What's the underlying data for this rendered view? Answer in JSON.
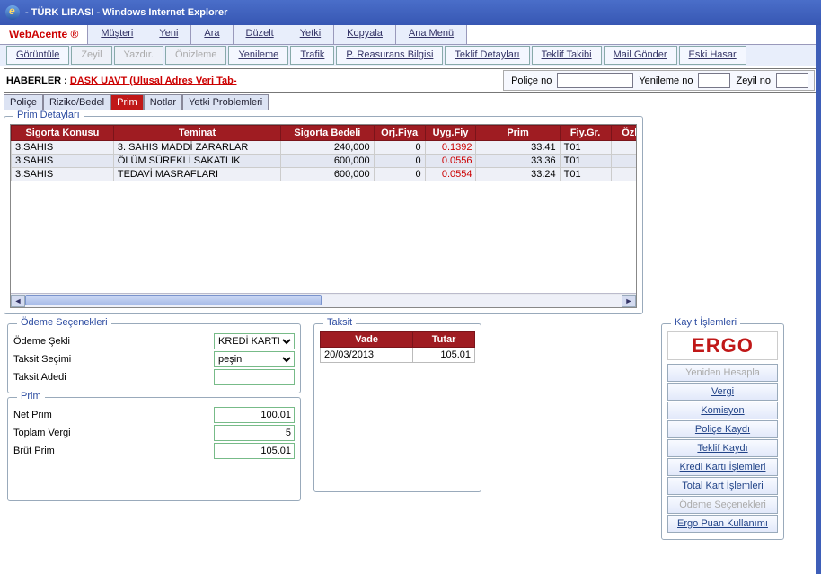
{
  "window": {
    "title": "- TÜRK LIRASI - Windows Internet Explorer"
  },
  "brand": "WebAcente ®",
  "menu": [
    "Müşteri",
    "Yeni",
    "Ara",
    "Düzelt",
    "Yetki",
    "Kopyala",
    "Ana Menü"
  ],
  "toolbar": [
    {
      "label": "Görüntüle",
      "disabled": false
    },
    {
      "label": "Zeyil",
      "disabled": true
    },
    {
      "label": "Yazdır.",
      "disabled": true
    },
    {
      "label": "Önizleme",
      "disabled": true
    },
    {
      "label": "Yenileme",
      "disabled": false
    },
    {
      "label": "Trafik",
      "disabled": false
    },
    {
      "label": "P. Reasurans Bilgisi",
      "disabled": false
    },
    {
      "label": "Teklif Detayları",
      "disabled": false
    },
    {
      "label": "Teklif Takibi",
      "disabled": false
    },
    {
      "label": "Mail Gönder",
      "disabled": false
    },
    {
      "label": "Eski Hasar",
      "disabled": false
    }
  ],
  "news": {
    "label": "HABERLER : ",
    "text": "DASK UAVT (Ulusal Adres Veri Tab-"
  },
  "policy_fields": {
    "police_label": "Poliçe no",
    "yenileme_label": "Yenileme no",
    "zeyil_label": "Zeyil no",
    "police_val": "",
    "yenileme_val": "",
    "zeyil_val": ""
  },
  "subtabs": [
    {
      "label": "Poliçe",
      "active": false
    },
    {
      "label": "Riziko/Bedel",
      "active": false
    },
    {
      "label": "Prim",
      "active": true
    },
    {
      "label": "Notlar",
      "active": false
    },
    {
      "label": "Yetki Problemleri",
      "active": false
    }
  ],
  "prim_legend": "Prim Detayları",
  "prim_headers": [
    "Sigorta Konusu",
    "Teminat",
    "Sigorta Bedeli",
    "Orj.Fiya",
    "Uyg.Fiy",
    "Prim",
    "Fiy.Gr.",
    "Özl"
  ],
  "prim_rows": [
    {
      "konu": "3.SAHIS",
      "teminat": "3. SAHIS MADDİ ZARARLAR",
      "bedel": "240,000",
      "orj": "0",
      "uyg": "0.1392",
      "prim": "33.41",
      "grp": "T01"
    },
    {
      "konu": "3.SAHIS",
      "teminat": "ÖLÜM SÜREKLİ SAKATLIK",
      "bedel": "600,000",
      "orj": "0",
      "uyg": "0.0556",
      "prim": "33.36",
      "grp": "T01"
    },
    {
      "konu": "3.SAHIS",
      "teminat": "TEDAVİ MASRAFLARI",
      "bedel": "600,000",
      "orj": "0",
      "uyg": "0.0554",
      "prim": "33.24",
      "grp": "T01"
    }
  ],
  "odeme": {
    "legend": "Ödeme Seçenekleri",
    "sekli_label": "Ödeme Şekli",
    "sekli_val": "KREDİ KARTI",
    "taksit_label": "Taksit Seçimi",
    "taksit_val": "peşin",
    "adet_label": "Taksit Adedi",
    "adet_val": ""
  },
  "prim_box": {
    "legend": "Prim",
    "net_label": "Net Prim",
    "net_val": "100.01",
    "vergi_label": "Toplam Vergi",
    "vergi_val": "5",
    "brut_label": "Brüt Prim",
    "brut_val": "105.01"
  },
  "taksit_box": {
    "legend": "Taksit",
    "headers": [
      "Vade",
      "Tutar"
    ],
    "rows": [
      {
        "vade": "20/03/2013",
        "tutar": "105.01"
      }
    ]
  },
  "kayit": {
    "legend": "Kayıt İşlemleri",
    "logo": "ERGO",
    "buttons": [
      {
        "label": "Yeniden Hesapla",
        "disabled": true
      },
      {
        "label": "Vergi",
        "disabled": false
      },
      {
        "label": "Komisyon",
        "disabled": false
      },
      {
        "label": "Poliçe Kaydı",
        "disabled": false
      },
      {
        "label": "Teklif Kaydı",
        "disabled": false
      },
      {
        "label": "Kredi Kartı İşlemleri",
        "disabled": false
      },
      {
        "label": "Total Kart İşlemleri",
        "disabled": false
      },
      {
        "label": "Ödeme Seçenekleri",
        "disabled": true
      },
      {
        "label": "Ergo Puan Kullanımı",
        "disabled": false
      }
    ]
  }
}
